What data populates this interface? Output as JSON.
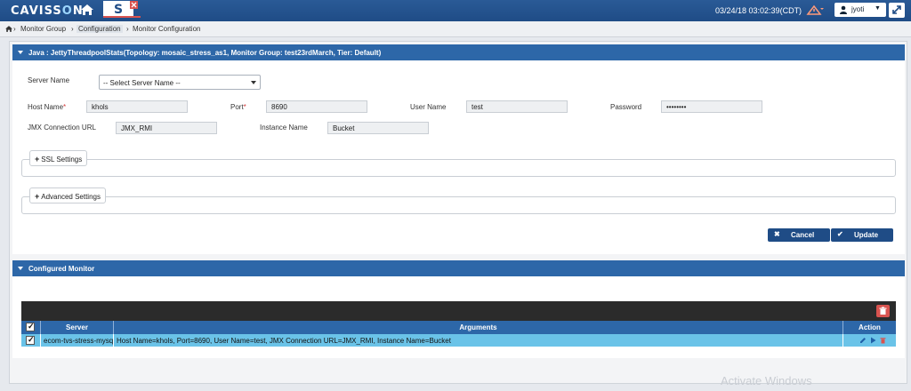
{
  "header": {
    "logo_text_a": "CAVISS",
    "logo_text_o": "O",
    "logo_text_b": "N",
    "datetime": "03/24/18 03:02:39(CDT)",
    "user": "jyoti"
  },
  "breadcrumb": {
    "items": [
      "Monitor Group",
      "Configuration",
      "Monitor Configuration"
    ]
  },
  "java_panel": {
    "title": "Java : JettyThreadpoolStats(Topology: mosaic_stress_as1, Monitor Group: test23rdMarch, Tier: Default)",
    "server_name_label": "Server Name",
    "server_select_value": "-- Select Server Name --",
    "host_name_label": "Host Name",
    "host_name_value": "khols",
    "port_label": "Port",
    "port_value": "8690",
    "user_name_label": "User Name",
    "user_name_value": "test",
    "password_label": "Password",
    "password_value": "••••••••",
    "jmx_label": "JMX Connection URL",
    "jmx_value": "JMX_RMI",
    "instance_label": "Instance Name",
    "instance_value": "Bucket",
    "ssl_settings": "SSL Settings",
    "advanced_settings": "Advanced Settings",
    "cancel": "Cancel",
    "update": "Update"
  },
  "configured_panel": {
    "title": "Configured Monitor",
    "columns": [
      "Server",
      "Arguments",
      "Action"
    ],
    "rows": [
      {
        "server": "ecom-tvs-stress-mysql",
        "arguments": "Host Name=khols, Port=8690, User Name=test, JMX Connection URL=JMX_RMI, Instance Name=Bucket"
      }
    ]
  },
  "watermark": "Activate Windows",
  "colors": {
    "header_blue": "#1f4c86",
    "panel_blue": "#2d67a8",
    "row_highlight": "#6ac3e8",
    "delete_red": "#d9534f"
  }
}
